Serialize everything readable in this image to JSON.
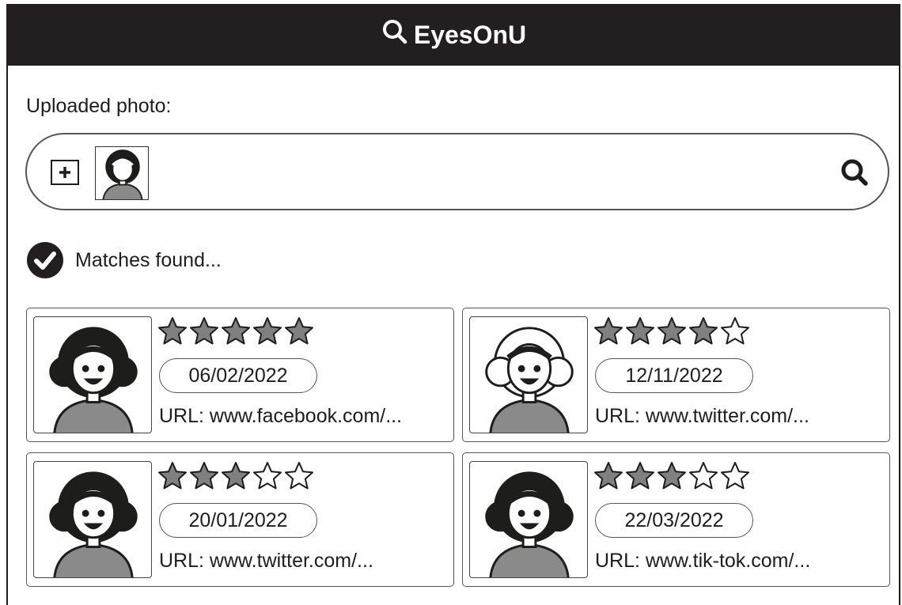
{
  "app": {
    "title": "EyesOnU"
  },
  "upload": {
    "label": "Uploaded photo:"
  },
  "status": {
    "text": "Matches found..."
  },
  "results": [
    {
      "rating": 5,
      "date": "06/02/2022",
      "url": "URL: www.facebook.com/...",
      "hair": "dark"
    },
    {
      "rating": 4,
      "date": "12/11/2022",
      "url": "URL: www.twitter.com/...",
      "hair": "light"
    },
    {
      "rating": 3,
      "date": "20/01/2022",
      "url": "URL: www.twitter.com/...",
      "hair": "dark"
    },
    {
      "rating": 3,
      "date": "22/03/2022",
      "url": "URL: www.tik-tok.com/...",
      "hair": "dark"
    }
  ],
  "colors": {
    "header_bg": "#231f20",
    "star_filled": "#808080",
    "star_empty": "#ffffff",
    "shirt": "#8a8a8a"
  },
  "icons": [
    "search-icon",
    "plus-icon",
    "check-circle-icon",
    "star-icon"
  ]
}
